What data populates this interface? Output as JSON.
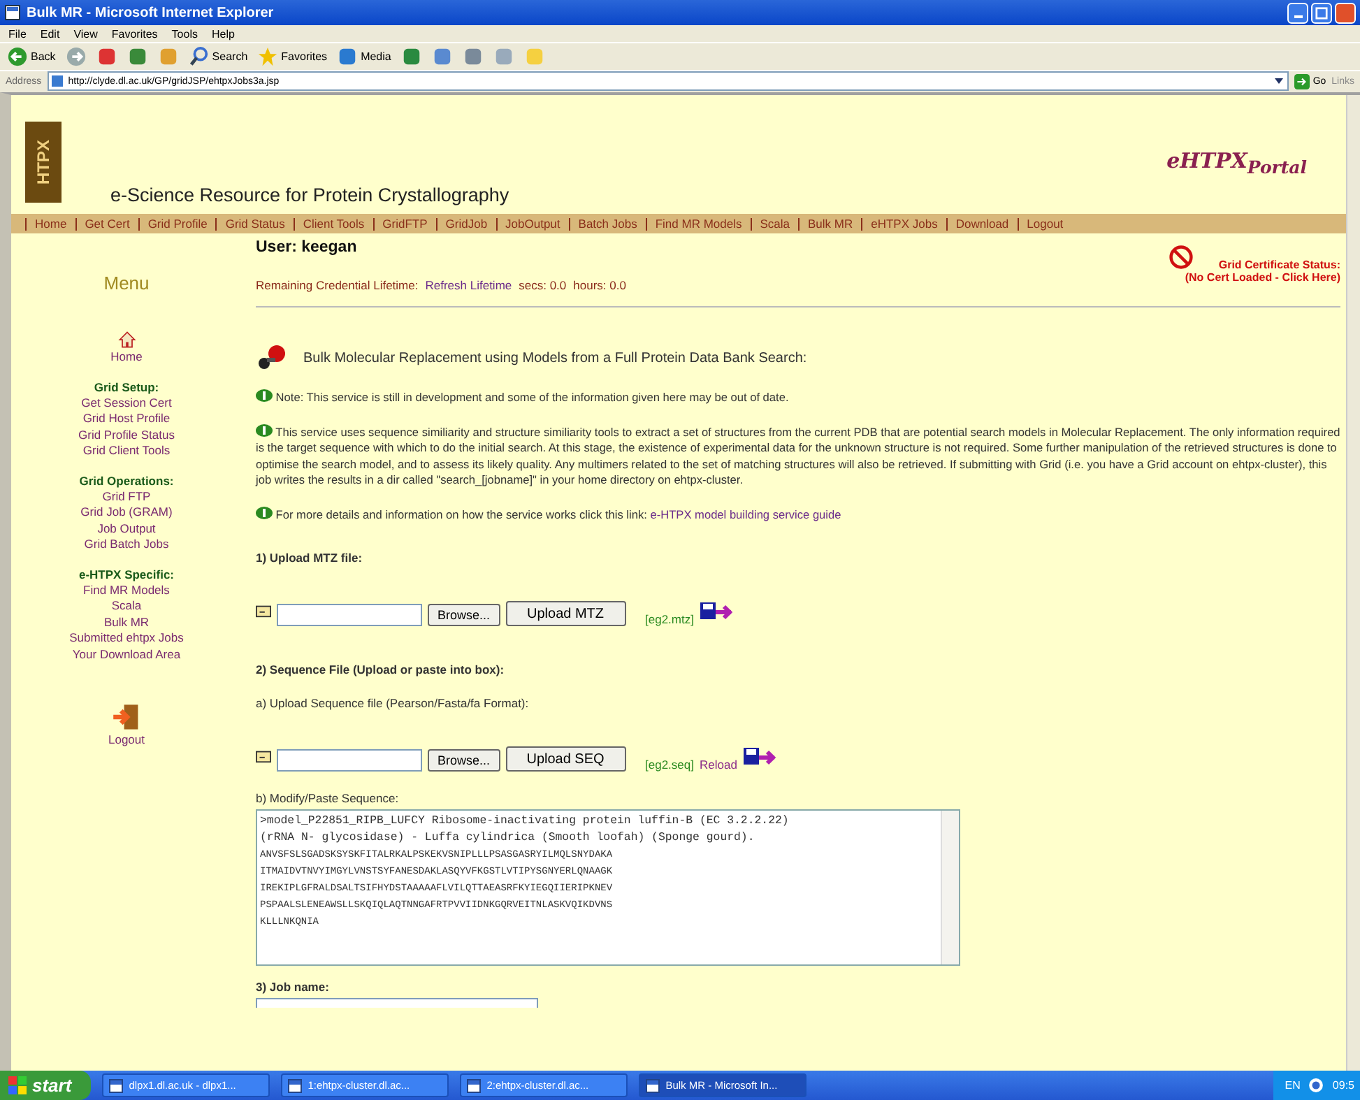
{
  "window": {
    "title": "Bulk MR - Microsoft Internet Explorer"
  },
  "menu_bar": [
    "File",
    "Edit",
    "View",
    "Favorites",
    "Tools",
    "Help"
  ],
  "toolbar": [
    {
      "kind": "back",
      "label": "Back"
    },
    {
      "kind": "forward"
    },
    {
      "kind": "stop"
    },
    {
      "kind": "refresh"
    },
    {
      "kind": "home"
    },
    {
      "kind": "search",
      "label": "Search"
    },
    {
      "kind": "favorites",
      "label": "Favorites"
    },
    {
      "kind": "media",
      "label": "Media"
    },
    {
      "kind": "history"
    },
    {
      "kind": "mail"
    },
    {
      "kind": "print"
    },
    {
      "kind": "edit"
    },
    {
      "kind": "note"
    }
  ],
  "address_bar": {
    "label": "Address",
    "url": "http://clyde.dl.ac.uk/GP/gridJSP/ehtpxJobs3a.jsp",
    "go": "Go",
    "links": "Links"
  },
  "header": {
    "logo_text": "HTPX",
    "title": "e-Science Resource for Protein Crystallography",
    "portal": "eHTPX$_{Portal}$"
  },
  "nav": [
    "Home",
    "Get Cert",
    "Grid Profile",
    "Grid Status",
    "Client Tools",
    "GridFTP",
    "GridJob",
    "JobOutput",
    "Batch Jobs",
    "Find MR Models",
    "Scala",
    "Bulk MR",
    "eHTPX Jobs",
    "Download",
    "Logout"
  ],
  "sidebar": {
    "title": "Menu",
    "home": "Home",
    "sections": [
      {
        "heading": "Grid Setup:",
        "links": [
          "Get Session Cert",
          "Grid Host Profile",
          "Grid Profile Status",
          "Grid Client Tools"
        ]
      },
      {
        "heading": "Grid Operations:",
        "links": [
          "Grid FTP",
          "Grid Job (GRAM)",
          "Job Output",
          "Grid Batch Jobs"
        ]
      },
      {
        "heading": "e-HTPX Specific:",
        "links": [
          "Find MR Models",
          "Scala",
          "Bulk MR",
          "Submitted ehtpx Jobs",
          "Your Download Area"
        ]
      }
    ],
    "logout": "Logout"
  },
  "user": "User: keegan",
  "credential": {
    "label": "Remaining Credential Lifetime:",
    "link": "Refresh Lifetime",
    "secs": "secs: 0.0",
    "hours": "hours: 0.0"
  },
  "cert_status": {
    "title": "Grid Certificate Status:",
    "detail": "(No Cert Loaded - Click Here)"
  },
  "heading": "Bulk Molecular Replacement using Models from a Full Protein Data Bank Search:",
  "notes": [
    {
      "text": "Note: This service is still in development and some of the information given here may be out of date."
    },
    {
      "text": "This service uses sequence similiarity and structure similiarity tools to extract a set of structures from the current PDB that are potential search models in Molecular Replacement. The only information required is the target sequence with which to do the initial search. At this stage, the existence of experimental data for the unknown structure is not required. Some further manipulation of the retrieved structures is done to optimise the search model, and to assess its likely quality. Any multimers related to the set of matching structures will also be retrieved. If submitting with Grid (i.e. you have a Grid account on ehtpx-cluster), this job writes the results in a dir called \"search_[jobname]\" in your home directory on ehtpx-cluster."
    },
    {
      "text": "For more details and information on how the service works click this link:",
      "link": "e-HTPX model building service guide"
    }
  ],
  "mtz": {
    "heading": "1) Upload MTZ file:",
    "browse": "Browse...",
    "upload": "Upload MTZ",
    "example": "[eg2.mtz]"
  },
  "sequence": {
    "heading": "2) Sequence File (Upload or paste into box):",
    "upload_label": "a) Upload Sequence file (Pearson/Fasta/fa Format):",
    "browse": "Browse...",
    "upload": "Upload SEQ",
    "example": "[eg2.seq]",
    "reload": "Reload",
    "paste_label": "b) Modify/Paste Sequence:",
    "lines": [
      ">model_P22851_RIPB_LUFCY Ribosome-inactivating protein luffin-B (EC 3.2.2.22)",
      "(rRNA N- glycosidase) - Luffa cylindrica (Smooth loofah) (Sponge gourd).",
      "ANVSFSLSGADSKSYSKFITALRKALPSKEKVSNIPLLLPSASGASRYILMQLSNYDAKA",
      "ITMAIDVTNVYIMGYLVNSTSYFANESDAKLASQYVFKGSTLVTIPYSGNYERLQNAAGK",
      "IREKIPLGFRALDSALTSIFHYDSTAAAAAFLVILQTTAEASRFKYIEGQIIERIPKNEV",
      "PSPAALSLENEAWSLLSKQIQLAQTNNGAFRTPVVIIDNKGQRVEITNLASKVQIKDVNS",
      "KLLLNKQNIA"
    ]
  },
  "job_name": {
    "heading": "3) Job name:"
  },
  "taskbar": {
    "start": "start",
    "tasks": [
      {
        "label": "dlpx1.dl.ac.uk - dlpx1...",
        "selected": false
      },
      {
        "label": "1:ehtpx-cluster.dl.ac...",
        "selected": false
      },
      {
        "label": "2:ehtpx-cluster.dl.ac...",
        "selected": false
      },
      {
        "label": "Bulk MR - Microsoft In...",
        "selected": true
      }
    ],
    "language": "EN",
    "clock": "09:5"
  }
}
